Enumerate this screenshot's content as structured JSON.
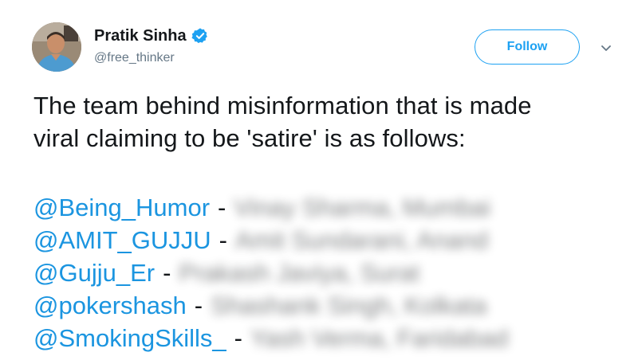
{
  "tweet": {
    "author": {
      "display_name": "Pratik Sinha",
      "handle": "@free_thinker",
      "verified": true
    },
    "follow_label": "Follow",
    "text_line_1": "The team behind misinformation that is made",
    "text_line_2": "viral claiming to be 'satire' is as follows:",
    "mentions": [
      {
        "handle": "@Being_Humor",
        "separator": "-",
        "redacted_name": "Vinay Sharma, Mumbai"
      },
      {
        "handle": "@AMIT_GUJJU",
        "separator": "-",
        "redacted_name": "Amit Sundarani, Anand"
      },
      {
        "handle": "@Gujju_Er",
        "separator": "-",
        "redacted_name": "Prakash Javiya, Surat"
      },
      {
        "handle": "@pokershash",
        "separator": "-",
        "redacted_name": "Shashank Singh, Kolkata"
      },
      {
        "handle": "@SmokingSkills_",
        "separator": "-",
        "redacted_name": "Yash Verma, Faridabad"
      }
    ]
  },
  "colors": {
    "accent": "#1da1f2",
    "link": "#1b95e0",
    "text": "#14171a",
    "secondary_text": "#657786"
  },
  "icons": {
    "verified": "verified-badge-icon",
    "menu": "chevron-down-icon"
  }
}
